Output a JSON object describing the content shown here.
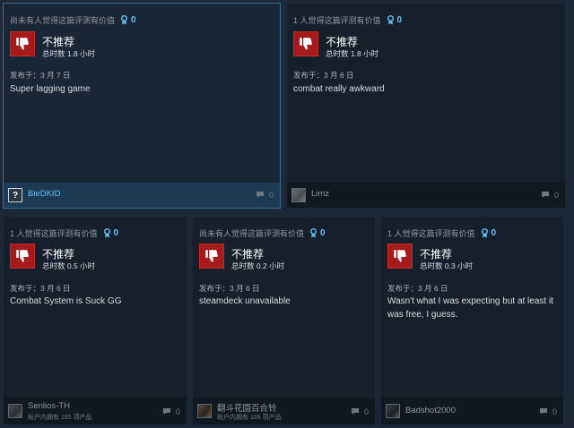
{
  "reviews": [
    {
      "helpful_text": "尚未有人觉得这篇评测有价值",
      "award_count": "0",
      "recommendation": "不推荐",
      "hours": "总时数 1.8 小时",
      "posted": "发布于：3 月 7 日",
      "body": "Super lagging game",
      "author": "BieDKID",
      "owned": "",
      "comment_count": "0",
      "avatar": "unknown-avatar-icon"
    },
    {
      "helpful_text": "1 人觉得这篇评测有价值",
      "award_count": "0",
      "recommendation": "不推荐",
      "hours": "总时数 1.8 小时",
      "posted": "发布于：3 月 6 日",
      "body": "combat really awkward",
      "author": "Limz",
      "owned": "",
      "comment_count": "0",
      "avatar": "avatar"
    },
    {
      "helpful_text": "1 人觉得这篇评测有价值",
      "award_count": "0",
      "recommendation": "不推荐",
      "hours": "总时数 0.5 小时",
      "posted": "发布于：3 月 6 日",
      "body": "Combat System is Suck GG",
      "author": "Senlios-TH",
      "owned": "帐户内拥有 165 项产品",
      "comment_count": "0",
      "avatar": "avatar"
    },
    {
      "helpful_text": "尚未有人觉得这篇评测有价值",
      "award_count": "0",
      "recommendation": "不推荐",
      "hours": "总时数 0.2 小时",
      "posted": "发布于：3 月 6 日",
      "body": "steamdeck unavailable",
      "author": "翻斗花園百合铃",
      "owned": "帐户内拥有 169 项产品",
      "comment_count": "0",
      "avatar": "avatar"
    },
    {
      "helpful_text": "1 人觉得这篇评测有价值",
      "award_count": "0",
      "recommendation": "不推荐",
      "hours": "总时数 0.3 小时",
      "posted": "发布于：3 月 6 日",
      "body": "Wasn't what I was expecting but at least it was free, I guess.",
      "author": "Badshot2000",
      "owned": "",
      "comment_count": "0",
      "avatar": "avatar"
    }
  ],
  "colors": {
    "background": "#1b2838",
    "card": "#16202d",
    "accent": "#66c0f4",
    "thumbs_down": "#a51a1a"
  }
}
